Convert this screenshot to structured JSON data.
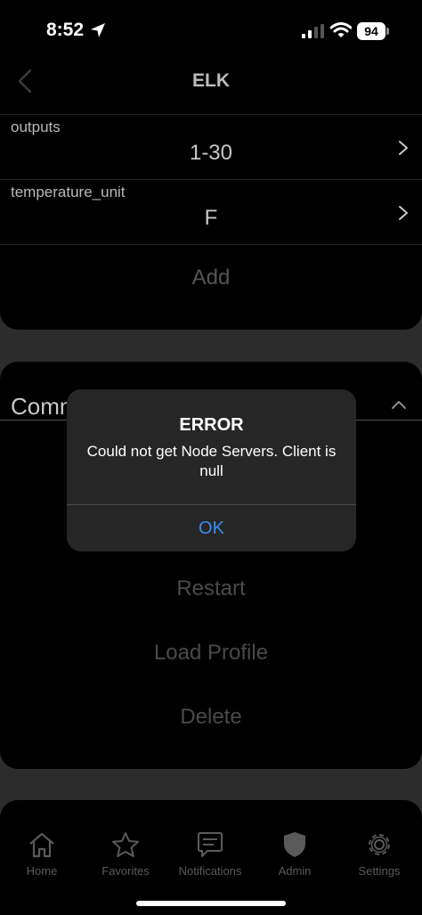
{
  "status_bar": {
    "time": "8:52",
    "battery": "94",
    "location_icon": "location-arrow-icon",
    "signal_icon": "cellular-signal-icon",
    "wifi_icon": "wifi-icon"
  },
  "header": {
    "title": "ELK",
    "back_icon": "chevron-left-icon"
  },
  "settings": {
    "rows": [
      {
        "key": "outputs",
        "value": "1-30"
      },
      {
        "key": "temperature_unit",
        "value": "F"
      }
    ],
    "add_label": "Add"
  },
  "commands": {
    "label": "Comm",
    "items": [
      "Restart",
      "Load Profile",
      "Delete"
    ]
  },
  "alert": {
    "title": "ERROR",
    "message": "Could not get Node Servers. Client is null",
    "ok_label": "OK"
  },
  "tabbar": {
    "items": [
      {
        "label": "Home",
        "icon": "home-icon"
      },
      {
        "label": "Favorites",
        "icon": "star-icon"
      },
      {
        "label": "Notifications",
        "icon": "chat-bubble-icon"
      },
      {
        "label": "Admin",
        "icon": "shield-icon"
      },
      {
        "label": "Settings",
        "icon": "gear-icon"
      }
    ]
  },
  "colors": {
    "background": "#2c2c2c",
    "card": "#000000",
    "alert_bg": "#262626",
    "accent": "#3a8bf0",
    "disabled_text": "#4a4a4a"
  }
}
